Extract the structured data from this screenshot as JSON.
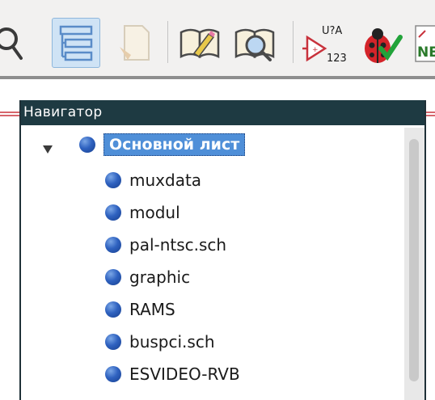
{
  "navigator": {
    "title": "Навигатор",
    "root": {
      "label": "Основной лист",
      "expanded": true,
      "selected": true
    },
    "items": [
      {
        "label": "muxdata"
      },
      {
        "label": "modul"
      },
      {
        "label": "pal-ntsc.sch"
      },
      {
        "label": "graphic"
      },
      {
        "label": "RAMS"
      },
      {
        "label": "buspci.sch"
      },
      {
        "label": "ESVIDEO-RVB"
      }
    ]
  },
  "toolbar": {
    "annotate_icon_text_top": "U?A",
    "annotate_icon_text_bottom": "123",
    "netlist_icon_text": "NE"
  },
  "colors": {
    "panel_header": "#1e3a42",
    "selection": "#4f8fd8",
    "bullet": "#2f62c0",
    "toolbar_active": "#cfe3f5"
  }
}
